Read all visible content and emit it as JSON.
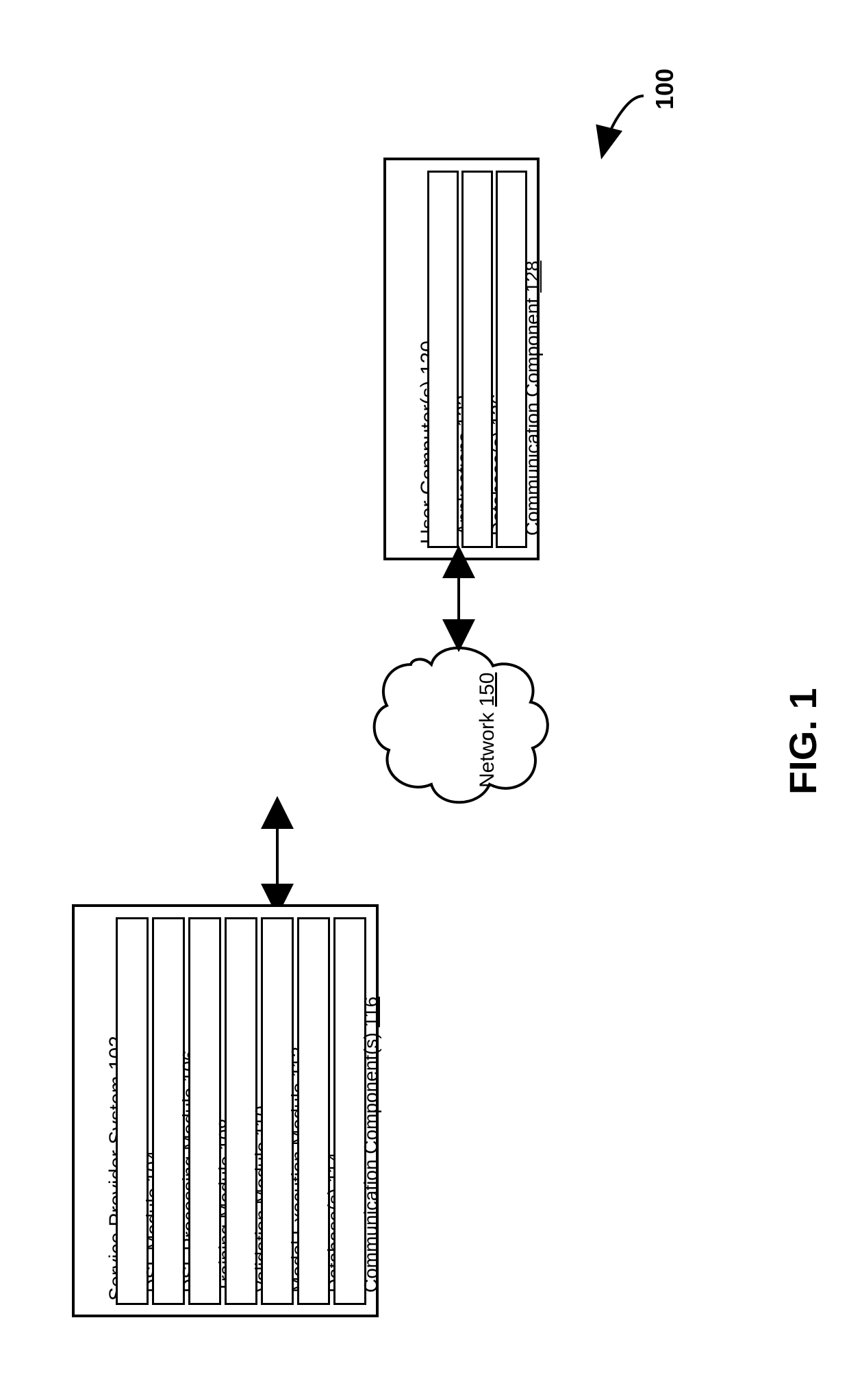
{
  "figure_ref": "100",
  "figure_label": "FIG. 1",
  "network": {
    "label": "Network",
    "num": "150"
  },
  "service_provider": {
    "title": "Service Provider System",
    "num": "102",
    "items": [
      {
        "label": "DSL Module",
        "num": "104"
      },
      {
        "label": "DSL Processing Module",
        "num": "106"
      },
      {
        "label": "Training Module",
        "num": "108"
      },
      {
        "label": "Validation Module",
        "num": "110"
      },
      {
        "label": "Model Execution Module",
        "num": "112"
      },
      {
        "label": "Database(s)",
        "num": "114"
      },
      {
        "label": "Communication Component(s)",
        "num": "116"
      }
    ]
  },
  "user_computer": {
    "title": "User Computer(s)",
    "num": "120",
    "items": [
      {
        "label": "Applications",
        "num": "122"
      },
      {
        "label": "Database(s)",
        "num": "126"
      },
      {
        "label": "Communication Component",
        "num": "128"
      }
    ]
  }
}
